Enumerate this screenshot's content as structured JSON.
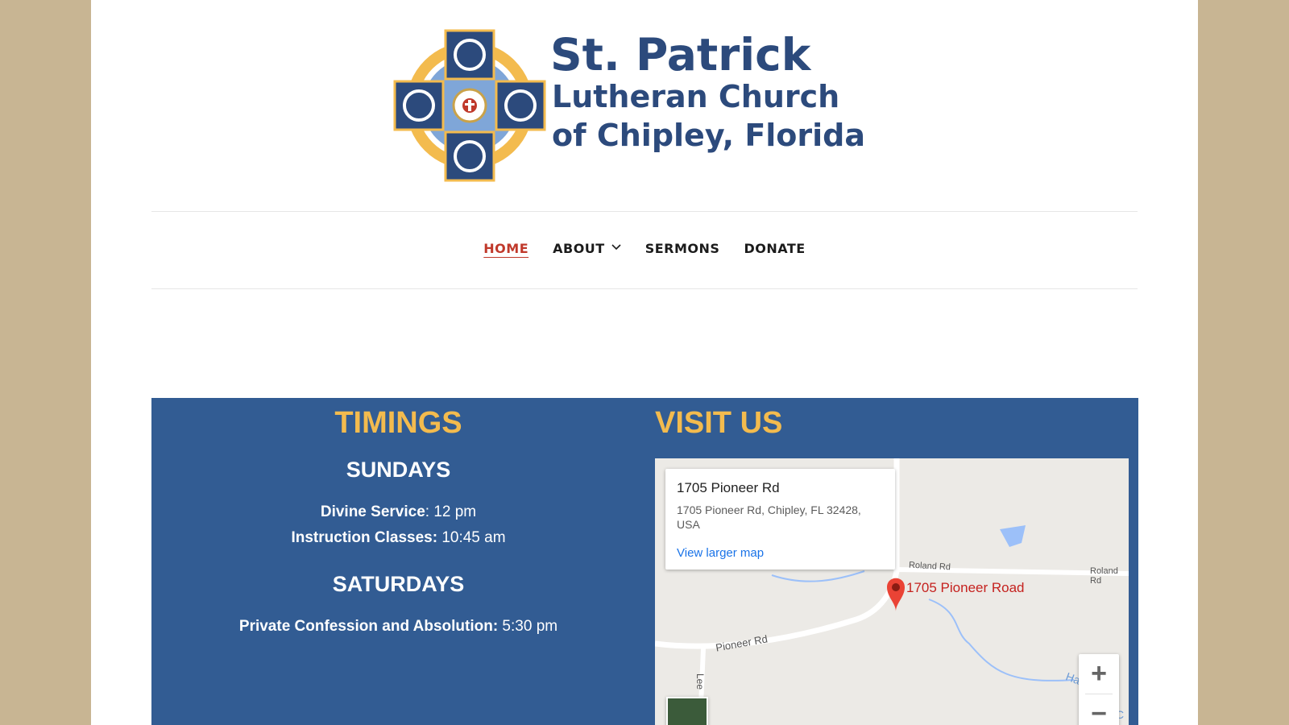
{
  "logo": {
    "title": "St. Patrick",
    "subtitle_line1": "Lutheran Church",
    "subtitle_line2": "of Chipley, Florida"
  },
  "nav": {
    "items": [
      {
        "label": "HOME",
        "active": true
      },
      {
        "label": "ABOUT",
        "has_dropdown": true
      },
      {
        "label": "SERMONS"
      },
      {
        "label": "DONATE"
      }
    ]
  },
  "timings": {
    "heading": "TIMINGS",
    "sundays": {
      "heading": "SUNDAYS",
      "divine_service_label": "Divine Service",
      "divine_service_time": ": 12 pm",
      "instruction_label": "Instruction Classes:",
      "instruction_time": " 10:45 am"
    },
    "saturdays": {
      "heading": "SATURDAYS",
      "confession_label": "Private Confession and Absolution:",
      "confession_time": " 5:30 pm"
    }
  },
  "visit": {
    "heading": "VISIT US",
    "map": {
      "info_title": "1705 Pioneer Rd",
      "info_address": "1705 Pioneer Rd, Chipley, FL 32428, USA",
      "view_larger": "View larger map",
      "pin_label": "1705 Pioneer Road",
      "roads": {
        "roland": "Roland Rd",
        "roland_right": "Roland Rd",
        "pioneer": "Pioneer Rd",
        "lee": "Lee",
        "ha": "Ha",
        "c": "C"
      },
      "zoom_in": "+",
      "zoom_out": "−"
    }
  },
  "colors": {
    "accent": "#f3bb4e",
    "section_bg": "#325c93",
    "nav_active": "#c0392b",
    "outer_bg": "#c8b593"
  }
}
